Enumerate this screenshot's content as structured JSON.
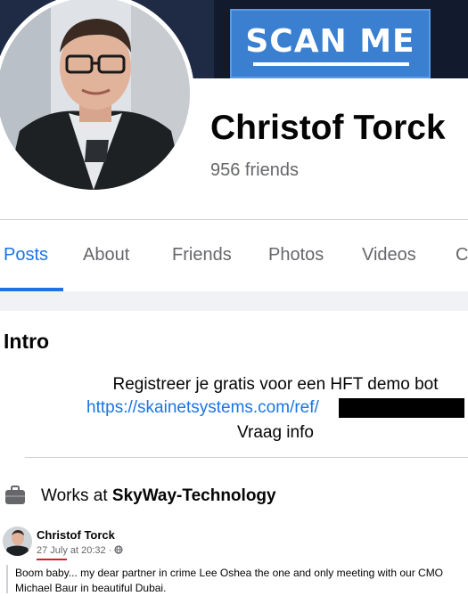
{
  "cover": {
    "banner_text": "SCAN ME"
  },
  "profile": {
    "name": "Christof Torck",
    "friends": "956 friends"
  },
  "tabs": [
    {
      "label": "Posts",
      "active": true
    },
    {
      "label": "About"
    },
    {
      "label": "Friends"
    },
    {
      "label": "Photos"
    },
    {
      "label": "Videos"
    },
    {
      "label": "C"
    }
  ],
  "intro": {
    "title": "Intro",
    "bio_line1": "Registreer je gratis voor een HFT demo bot",
    "bio_link": "https://skainetsystems.com/ref/",
    "bio_line3": "Vraag info",
    "work_prefix": "Works at",
    "work_company": "SkyWay-Technology"
  },
  "post": {
    "author": "Christof Torck",
    "date": "27 July",
    "time": " at 20:32 · ",
    "text": "Boom baby... my dear partner in crime Lee Oshea the one and only meeting with our CMO Michael Baur in beautiful Dubai."
  },
  "colors": {
    "accent": "#1b74e4",
    "cover": "#121a2e",
    "scan_box": "#3b7fd0",
    "underline": "#d0202a"
  },
  "icons": {
    "work": "briefcase-icon",
    "privacy": "globe-icon"
  }
}
